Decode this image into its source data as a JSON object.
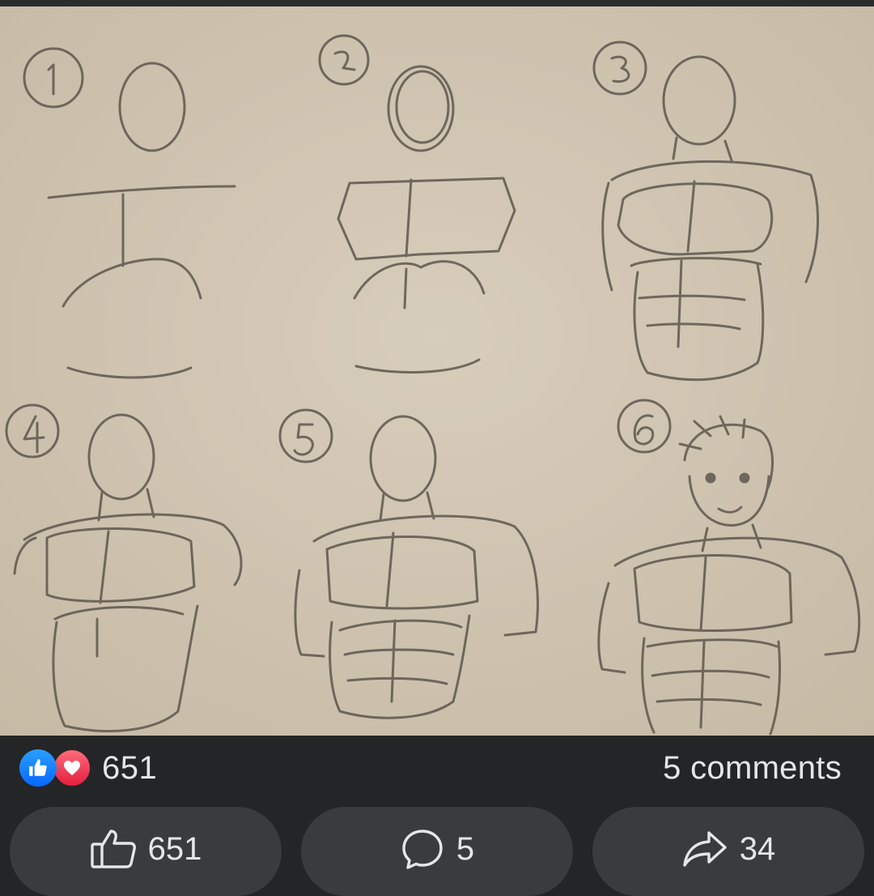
{
  "post": {
    "reactions": {
      "types": [
        "like",
        "love"
      ],
      "count": "651",
      "colors": {
        "like": "#0866ff",
        "love": "#e41e3f"
      }
    },
    "comments_summary": "5 comments"
  },
  "actions": {
    "like_count": "651",
    "comment_count": "5",
    "share_count": "34"
  },
  "drawing": {
    "step_labels": [
      "1",
      "2",
      "3",
      "4",
      "5",
      "6"
    ]
  },
  "icons": [
    "like-icon",
    "love-icon",
    "thumbs-up-icon",
    "comment-bubble-icon",
    "share-arrow-icon"
  ],
  "theme": {
    "background": "#242526",
    "button": "#3a3b3c",
    "text": "#e4e6eb",
    "paper": "#d3c8b5",
    "pencil": "#5e574e"
  }
}
